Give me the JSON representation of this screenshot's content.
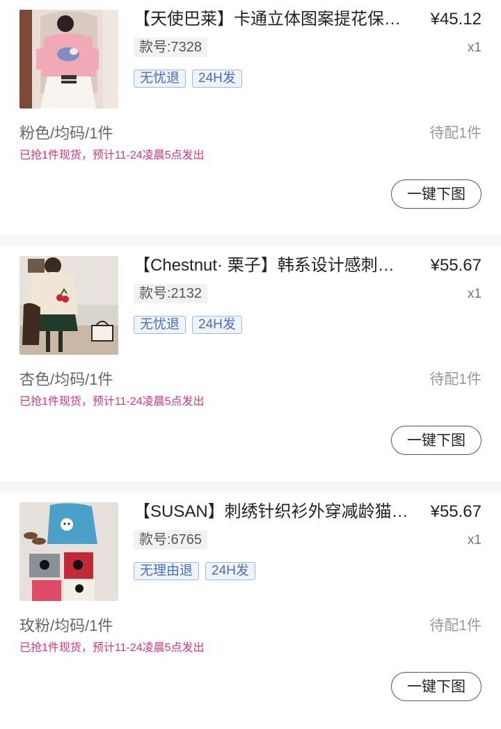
{
  "orders": [
    {
      "title": "【天使巴莱】卡通立体图案提花保…",
      "price": "¥45.12",
      "sku": "款号:7328",
      "quantity": "x1",
      "tags": [
        "无忧退",
        "24H发"
      ],
      "spec": "粉色/均码/1件",
      "status": "待配1件",
      "ship_note": "已抢1件现货，预计11-24凌晨5点发出",
      "action_label": "一键下图",
      "image": "pink-sweater-photo"
    },
    {
      "title": "【Chestnut· 栗子】韩系设计感刺…",
      "price": "¥55.67",
      "sku": "款号:2132",
      "quantity": "x1",
      "tags": [
        "无忧退",
        "24H发"
      ],
      "spec": "杏色/均码/1件",
      "status": "待配1件",
      "ship_note": "已抢1件现货，预计11-24凌晨5点发出",
      "action_label": "一键下图",
      "image": "beige-cherry-sweater-photo"
    },
    {
      "title": "【SUSAN】刺绣针织衫外穿减龄猫…",
      "price": "¥55.67",
      "sku": "款号:6765",
      "quantity": "x1",
      "tags": [
        "无理由退",
        "24H发"
      ],
      "spec": "玫粉/均码/1件",
      "status": "待配1件",
      "ship_note": "已抢1件现货，预计11-24凌晨5点发出",
      "action_label": "一键下图",
      "image": "cat-knit-sweaters-photo"
    }
  ],
  "colors": {
    "accent_pink": "#e0337a",
    "tag_blue": "#4a6fc0",
    "muted_gray": "#999999"
  }
}
